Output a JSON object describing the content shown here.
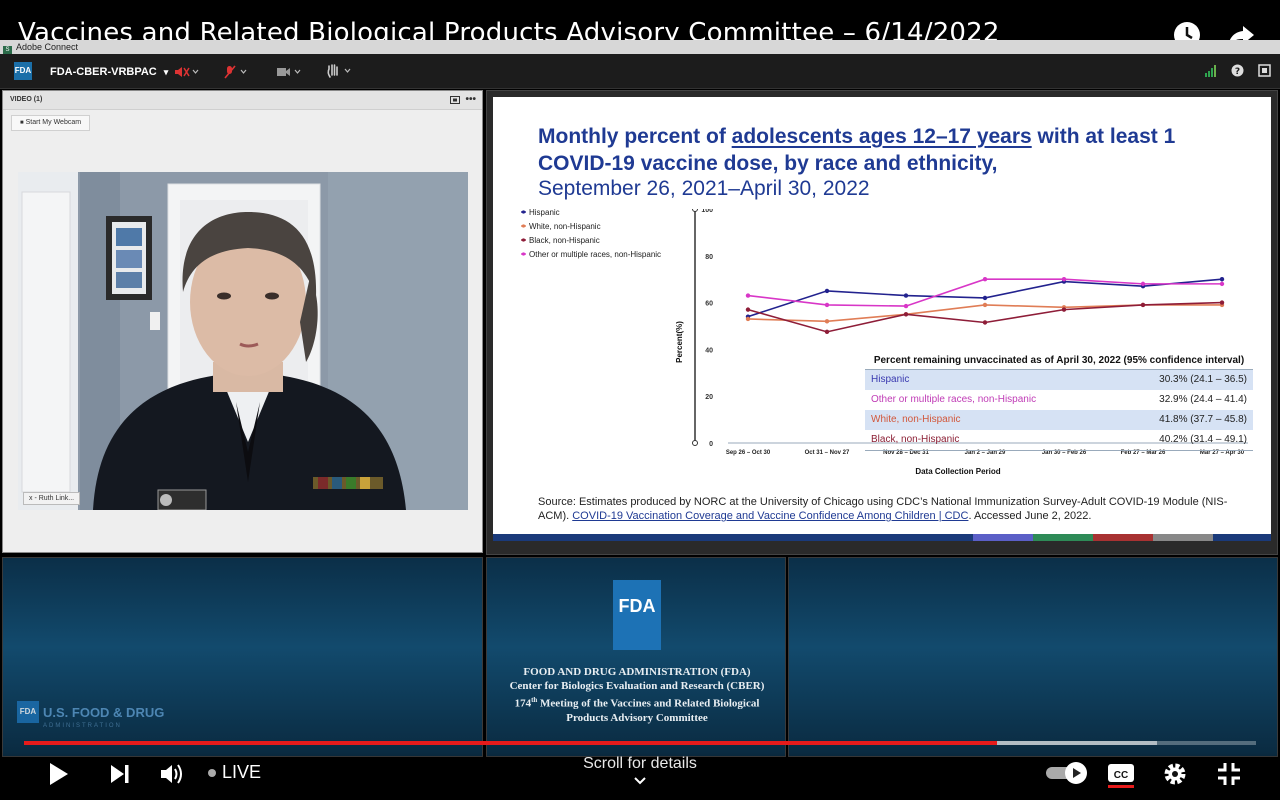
{
  "youtube": {
    "title": "Vaccines and Related Biological Products Advisory Committee – 6/14/2022",
    "live_label": "LIVE",
    "scroll_label": "Scroll for details",
    "progress": {
      "played_fraction": 0.79,
      "buffered_fraction": 0.92
    }
  },
  "adobe_connect": {
    "window_title": "Adobe Connect",
    "badge": "FDA",
    "room_name": "FDA-CBER-VRBPAC"
  },
  "video_pod": {
    "header": "VIDEO (1)",
    "webcam_button": "Start My Webcam",
    "name_tag": "x - Ruth Link..."
  },
  "slide": {
    "title_pre": "Monthly percent of ",
    "title_underlined": "adolescents ages 12–17 years",
    "title_post": " with at least 1 COVID-19 vaccine dose, by race and ethnicity,",
    "subtitle": "September 26, 2021–April 30, 2022",
    "source_pre": "Source: Estimates produced by NORC at the University of Chicago using CDC’s National Immunization Survey-Adult COVID-19 Module (NIS-ACM). ",
    "source_link": "COVID-19 Vaccination Coverage and Vaccine Confidence Among Children | CDC",
    "source_post": ". Accessed June 2, 2022.",
    "table": {
      "header": "Percent remaining unvaccinated as of April 30, 2022 (95% confidence interval)",
      "rows": [
        {
          "label": "Hispanic",
          "value": "30.3% (24.1 – 36.5)",
          "color": "#3a3ab0"
        },
        {
          "label": "Other or multiple races, non-Hispanic",
          "value": "32.9% (24.4 – 41.4)",
          "color": "#c03cb6"
        },
        {
          "label": "White, non-Hispanic",
          "value": "41.8% (37.7 – 45.8)",
          "color": "#d2573a"
        },
        {
          "label": "Black, non-Hispanic",
          "value": "40.2% (31.4 – 49.1)",
          "color": "#8b1f35"
        }
      ]
    }
  },
  "chart_data": {
    "type": "line",
    "categories": [
      "Sep 26 – Oct 30",
      "Oct 31 – Nov 27",
      "Nov 28 – Dec 31",
      "Jan 2 – Jan 29",
      "Jan 30 – Feb 26",
      "Feb 27 – Mar 26",
      "Mar 27 – Apr 30"
    ],
    "series": [
      {
        "name": "Hispanic",
        "color": "#22228e",
        "values": [
          54,
          65,
          63,
          62,
          69,
          67,
          70
        ]
      },
      {
        "name": "White, non-Hispanic",
        "color": "#e07d56",
        "values": [
          53,
          52,
          55,
          59,
          58,
          59,
          59
        ]
      },
      {
        "name": "Black, non-Hispanic",
        "color": "#8e1d38",
        "values": [
          57,
          47.5,
          55,
          51.5,
          57,
          59,
          60
        ]
      },
      {
        "name": "Other or multiple races, non-Hispanic",
        "color": "#d836c7",
        "values": [
          63,
          59,
          58.5,
          70,
          70,
          68,
          68
        ]
      }
    ],
    "xlabel": "Data Collection Period",
    "ylabel": "Percent(%)",
    "ylim": [
      0,
      100
    ],
    "yticks": [
      0,
      20,
      40,
      60,
      80,
      100
    ],
    "legend_position": "top-left",
    "grid": false
  },
  "fda_panel": {
    "logo": "FDA",
    "lines": [
      "FOOD AND DRUG ADMINISTRATION (FDA)",
      "Center for Biologics Evaluation and Research (CBER)",
      "174",
      "th",
      " Meeting of the Vaccines and Related Biological",
      "Products Advisory Committee"
    ],
    "left_logo_badge": "FDA",
    "left_logo_text": "U.S. FOOD & DRUG",
    "left_logo_sub": "ADMINISTRATION"
  }
}
